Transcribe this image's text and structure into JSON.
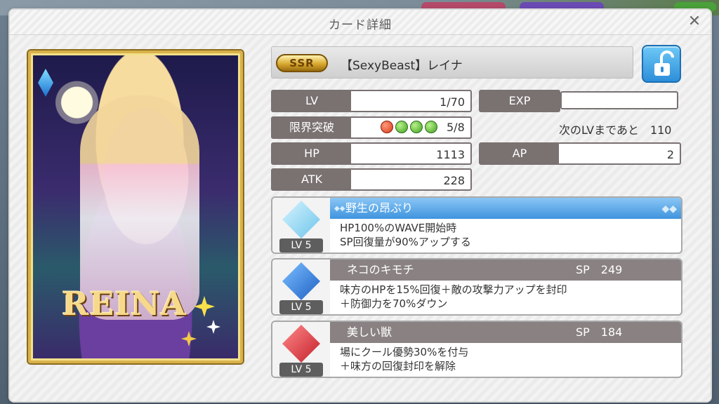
{
  "dialog": {
    "title": "カード詳細",
    "close_glyph": "✕"
  },
  "card": {
    "rarity": "SSR",
    "name": "【SexyBeast】レイナ",
    "art_name": "REINA"
  },
  "stats": {
    "lv_label": "LV",
    "lv_value": "1/70",
    "exp_label": "EXP",
    "limit_break_label": "限界突破",
    "limit_break_value": "5/8",
    "limit_break_orbs": [
      "red",
      "green",
      "green",
      "green"
    ],
    "next_lv_text": "次のLVまであと　110",
    "hp_label": "HP",
    "hp_value": "1113",
    "ap_label": "AP",
    "ap_value": "2",
    "atk_label": "ATK",
    "atk_value": "228"
  },
  "skills": [
    {
      "name": "野生の昂ぶり",
      "sp": "",
      "level": "LV 5",
      "line1": "HP100%のWAVE開始時",
      "line2": "SP回復量が90%アップする",
      "icon": "passive-crystal-icon",
      "color": "#8fd6f0"
    },
    {
      "name": "ネコのキモチ",
      "sp": "SP　249",
      "level": "LV 5",
      "line1": "味方のHPを15%回復＋敵の攻撃力アップを封印",
      "line2": "＋防御力を70%ダウン",
      "icon": "shield-down-icon",
      "color": "#2f7fd8"
    },
    {
      "name": "美しい獣",
      "sp": "SP　184",
      "level": "LV 5",
      "line1": "場にクール優勢30%を付与",
      "line2": "＋味方の回復封印を解除",
      "icon": "sword-up-icon",
      "color": "#e0343a"
    }
  ]
}
